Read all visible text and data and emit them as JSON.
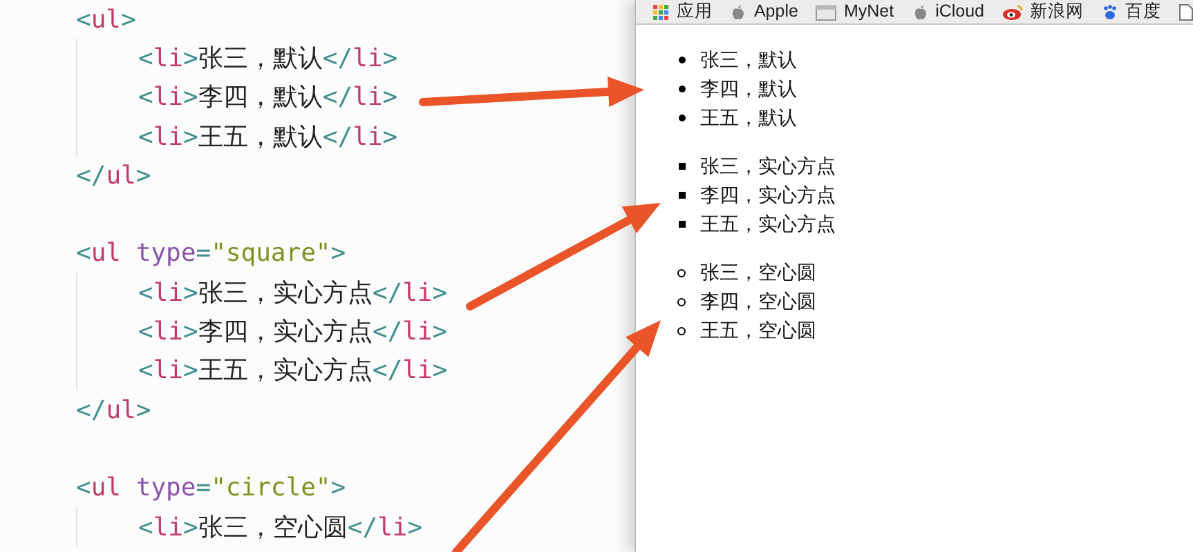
{
  "code_lines": [
    {
      "kind": "open",
      "tokens": [
        {
          "kind": "punct",
          "text": "<"
        },
        {
          "kind": "name",
          "text": "ul"
        },
        {
          "kind": "punct",
          "text": ">"
        }
      ]
    },
    {
      "kind": "item",
      "tokens": [
        {
          "kind": "punct",
          "text": "<"
        },
        {
          "kind": "name",
          "text": "li"
        },
        {
          "kind": "punct",
          "text": ">"
        },
        {
          "kind": "text",
          "text": "张三，默认"
        },
        {
          "kind": "punct",
          "text": "</"
        },
        {
          "kind": "name",
          "text": "li"
        },
        {
          "kind": "punct",
          "text": ">"
        }
      ]
    },
    {
      "kind": "item",
      "tokens": [
        {
          "kind": "punct",
          "text": "<"
        },
        {
          "kind": "name",
          "text": "li"
        },
        {
          "kind": "punct",
          "text": ">"
        },
        {
          "kind": "text",
          "text": "李四，默认"
        },
        {
          "kind": "punct",
          "text": "</"
        },
        {
          "kind": "name",
          "text": "li"
        },
        {
          "kind": "punct",
          "text": ">"
        }
      ]
    },
    {
      "kind": "item",
      "tokens": [
        {
          "kind": "punct",
          "text": "<"
        },
        {
          "kind": "name",
          "text": "li"
        },
        {
          "kind": "punct",
          "text": ">"
        },
        {
          "kind": "text",
          "text": "王五，默认"
        },
        {
          "kind": "punct",
          "text": "</"
        },
        {
          "kind": "name",
          "text": "li"
        },
        {
          "kind": "punct",
          "text": ">"
        }
      ]
    },
    {
      "kind": "close",
      "tokens": [
        {
          "kind": "punct",
          "text": "</"
        },
        {
          "kind": "name",
          "text": "ul"
        },
        {
          "kind": "punct",
          "text": ">"
        }
      ]
    },
    {
      "kind": "blank"
    },
    {
      "kind": "open",
      "tokens": [
        {
          "kind": "punct",
          "text": "<"
        },
        {
          "kind": "name",
          "text": "ul "
        },
        {
          "kind": "attr",
          "text": "type"
        },
        {
          "kind": "punct",
          "text": "="
        },
        {
          "kind": "value",
          "text": "\"square\""
        },
        {
          "kind": "punct",
          "text": ">"
        }
      ]
    },
    {
      "kind": "item",
      "tokens": [
        {
          "kind": "punct",
          "text": "<"
        },
        {
          "kind": "name",
          "text": "li"
        },
        {
          "kind": "punct",
          "text": ">"
        },
        {
          "kind": "text",
          "text": "张三，实心方点"
        },
        {
          "kind": "punct",
          "text": "</"
        },
        {
          "kind": "name",
          "text": "li"
        },
        {
          "kind": "punct",
          "text": ">"
        }
      ]
    },
    {
      "kind": "item",
      "tokens": [
        {
          "kind": "punct",
          "text": "<"
        },
        {
          "kind": "name",
          "text": "li"
        },
        {
          "kind": "punct",
          "text": ">"
        },
        {
          "kind": "text",
          "text": "李四，实心方点"
        },
        {
          "kind": "punct",
          "text": "</"
        },
        {
          "kind": "name",
          "text": "li"
        },
        {
          "kind": "punct",
          "text": ">"
        }
      ]
    },
    {
      "kind": "item",
      "tokens": [
        {
          "kind": "punct",
          "text": "<"
        },
        {
          "kind": "name",
          "text": "li"
        },
        {
          "kind": "punct",
          "text": ">"
        },
        {
          "kind": "text",
          "text": "王五，实心方点"
        },
        {
          "kind": "punct",
          "text": "</"
        },
        {
          "kind": "name",
          "text": "li"
        },
        {
          "kind": "punct",
          "text": ">"
        }
      ]
    },
    {
      "kind": "close",
      "tokens": [
        {
          "kind": "punct",
          "text": "</"
        },
        {
          "kind": "name",
          "text": "ul"
        },
        {
          "kind": "punct",
          "text": ">"
        }
      ]
    },
    {
      "kind": "blank"
    },
    {
      "kind": "open",
      "tokens": [
        {
          "kind": "punct",
          "text": "<"
        },
        {
          "kind": "name",
          "text": "ul "
        },
        {
          "kind": "attr",
          "text": "type"
        },
        {
          "kind": "punct",
          "text": "="
        },
        {
          "kind": "value",
          "text": "\"circle\""
        },
        {
          "kind": "punct",
          "text": ">"
        }
      ]
    },
    {
      "kind": "item",
      "tokens": [
        {
          "kind": "punct",
          "text": "<"
        },
        {
          "kind": "name",
          "text": "li"
        },
        {
          "kind": "punct",
          "text": ">"
        },
        {
          "kind": "text",
          "text": "张三，空心圆"
        },
        {
          "kind": "punct",
          "text": "</"
        },
        {
          "kind": "name",
          "text": "li"
        },
        {
          "kind": "punct",
          "text": ">"
        }
      ]
    }
  ],
  "bookmarks": [
    {
      "kind": "apps",
      "label": "应用"
    },
    {
      "kind": "apple",
      "label": "Apple"
    },
    {
      "kind": "folder",
      "label": "MyNet"
    },
    {
      "kind": "apple",
      "label": "iCloud"
    },
    {
      "kind": "eye",
      "label": "新浪网"
    },
    {
      "kind": "paw",
      "label": "百度"
    },
    {
      "kind": "page"
    }
  ],
  "lists": [
    {
      "kind": "disc",
      "items": [
        "张三，默认",
        "李四，默认",
        "王五，默认"
      ]
    },
    {
      "kind": "square",
      "items": [
        "张三，实心方点",
        "李四，实心方点",
        "王五，实心方点"
      ]
    },
    {
      "kind": "circle",
      "items": [
        "张三，空心圆",
        "李四，空心圆",
        "王五，空心圆"
      ]
    }
  ]
}
